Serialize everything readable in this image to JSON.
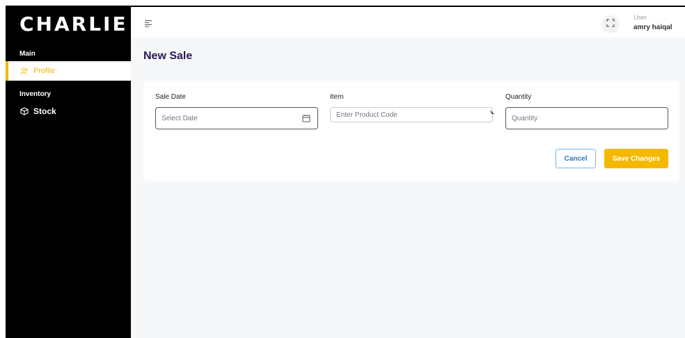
{
  "brand": {
    "name": "CHARLIE"
  },
  "sidebar": {
    "sections": [
      {
        "label": "Main"
      },
      {
        "label": "Inventory"
      }
    ],
    "items": [
      {
        "label": "Profile",
        "icon": "user-icon",
        "active": true
      },
      {
        "label": "Stock",
        "icon": "box-icon",
        "active": false
      }
    ]
  },
  "topbar": {
    "menu_icon": "menu-icon",
    "fullscreen_icon": "fullscreen-icon",
    "user_role": "User",
    "user_name": "amry haiqal"
  },
  "page": {
    "title": "New Sale",
    "fields": {
      "sale_date": {
        "label": "Sale Date",
        "placeholder": "Select Date",
        "value": ""
      },
      "item": {
        "label": "Item",
        "placeholder": "Enter Product Code",
        "value": ""
      },
      "quantity": {
        "label": "Quantity",
        "placeholder": "Quantity",
        "value": ""
      }
    },
    "actions": {
      "cancel_label": "Cancel",
      "save_label": "Save Changes"
    }
  },
  "colors": {
    "accent": "#f5b800",
    "sidebar_bg": "#000000",
    "title": "#2b1b4e",
    "cancel_border": "#7ab6e6"
  }
}
